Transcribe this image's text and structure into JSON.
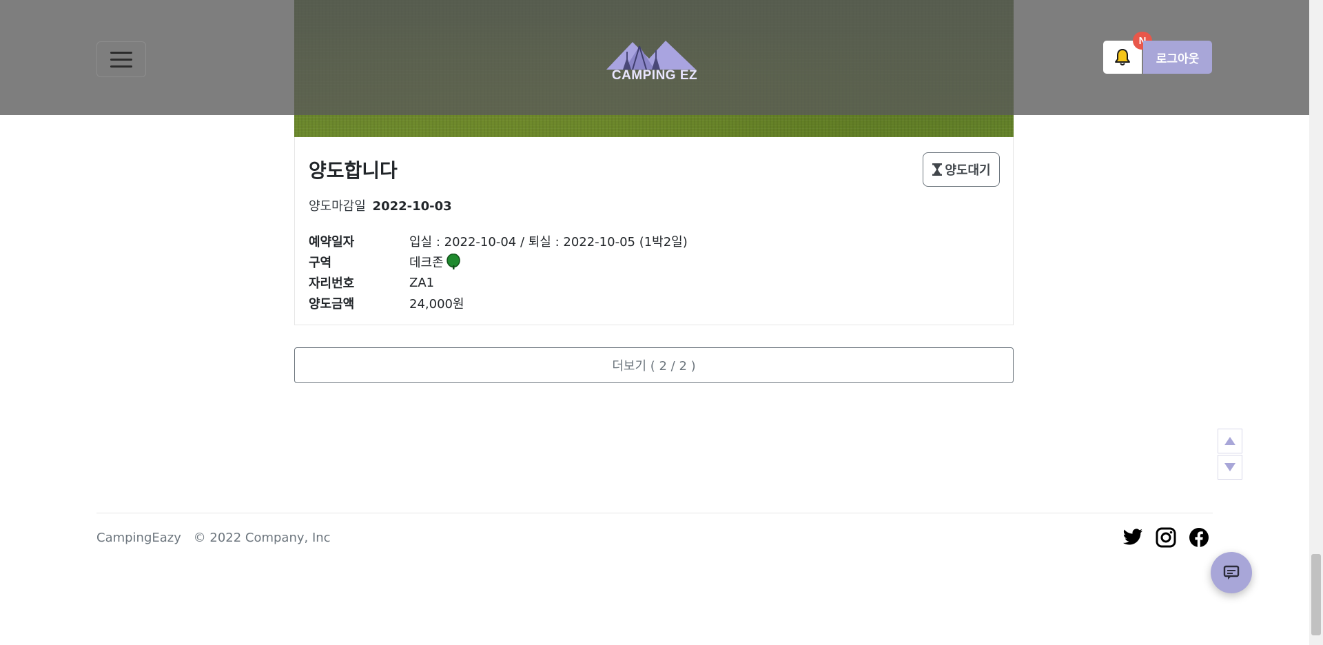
{
  "header": {
    "logo_text": "CAMPING EZ",
    "notification_badge": "N",
    "logout_label": "로그아웃"
  },
  "card": {
    "title": "양도합니다",
    "status_label": "양도대기",
    "deadline_label": "양도마감일",
    "deadline_value": "2022-10-03",
    "rows": [
      {
        "label": "예약일자",
        "value": "입실 : 2022-10-04 / 퇴실 : 2022-10-05 (1박2일)"
      },
      {
        "label": "구역",
        "value": "데크존",
        "icon": "tree-icon"
      },
      {
        "label": "자리번호",
        "value": "ZA1"
      },
      {
        "label": "양도금액",
        "value": "24,000원"
      }
    ]
  },
  "more_button": "더보기 ( 2 / 2 )",
  "footer": {
    "brand": "CampingEazy",
    "copyright": "© 2022 Company, Inc"
  },
  "socials": [
    "twitter-icon",
    "instagram-icon",
    "facebook-icon"
  ],
  "colors": {
    "accent": "#a8a6d8",
    "badge": "#e8574a",
    "header_overlay": "#5a5a5a"
  }
}
